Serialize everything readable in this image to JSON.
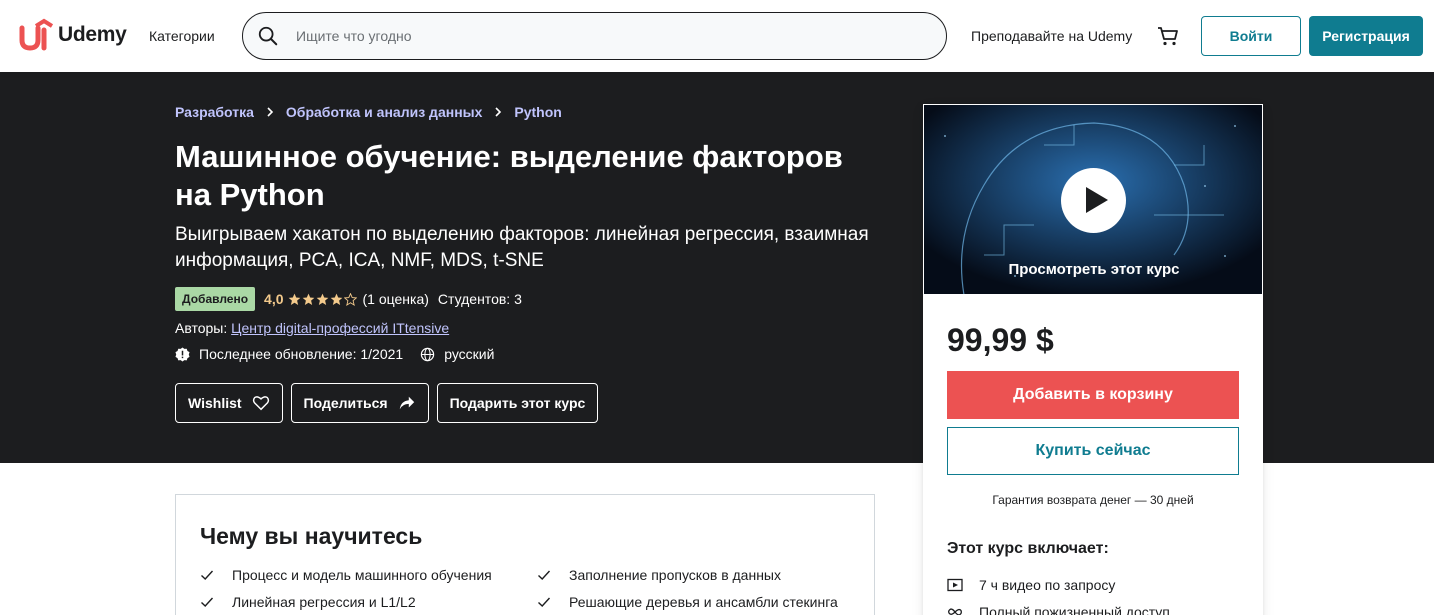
{
  "colors": {
    "dark": "#1c1d1f",
    "brand_red": "#ec5252",
    "teal": "#0f7c90",
    "link_light": "#c0c4fc",
    "rating_orange": "#f3ca8c",
    "badge_green": "#aad8a5"
  },
  "header": {
    "logo_text": "Udemy",
    "categories": "Категории",
    "search_placeholder": "Ищите что угодно",
    "teach": "Преподавайте на Udemy",
    "login": "Войти",
    "signup": "Регистрация"
  },
  "breadcrumb": [
    "Разработка",
    "Обработка и анализ данных",
    "Python"
  ],
  "course": {
    "title": "Машинное обучение: выделение факторов на Python",
    "subtitle": "Выигрываем хакатон по выделению факторов: линейная регрессия, взаимная информация, PCA, ICA, NMF, MDS, t-SNE",
    "badge": "Добавлено",
    "rating": "4,0",
    "rating_value": 4.0,
    "rating_count": "(1 оценка)",
    "students": "Студентов: 3",
    "authors_label": "Авторы:",
    "author": "Центр digital-профессий ITtensive",
    "updated": "Последнее обновление: 1/2021",
    "language": "русский"
  },
  "actions": {
    "wishlist": "Wishlist",
    "share": "Поделиться",
    "gift": "Подарить этот курс"
  },
  "sidebar": {
    "preview_label": "Просмотреть этот курс",
    "price": "99,99 $",
    "add_to_cart": "Добавить в корзину",
    "buy_now": "Купить сейчас",
    "guarantee": "Гарантия возврата денег — 30 дней",
    "includes_title": "Этот курс включает:",
    "includes": [
      {
        "icon": "video-icon",
        "text": "7 ч видео по запросу"
      },
      {
        "icon": "infinity-icon",
        "text": "Полный пожизненный доступ"
      }
    ]
  },
  "learn": {
    "title": "Чему вы научитесь",
    "items": [
      "Процесс и модель машинного обучения",
      "Заполнение пропусков в данных",
      "Линейная регрессия и L1/L2",
      "Решающие деревья и ансамбли стекинга"
    ]
  }
}
